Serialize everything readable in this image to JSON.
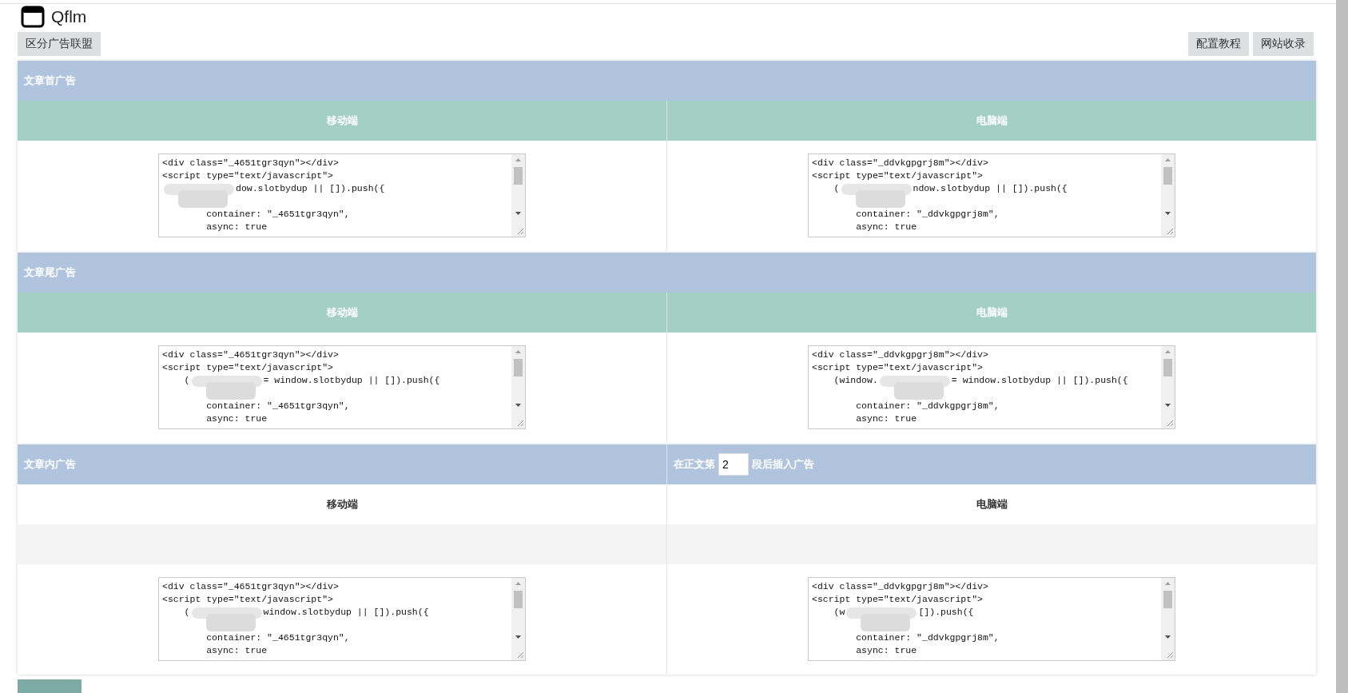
{
  "app": {
    "title": "Qflm"
  },
  "toolbar": {
    "left_buttons": [
      "区分广告联盟"
    ],
    "right_buttons": [
      "配置教程",
      "网站收录"
    ]
  },
  "sections": [
    {
      "title": "文章首广告",
      "kind": "standard",
      "columns": [
        {
          "label": "移动端",
          "head": [
            "<div class=\"_4651tgr3qyn\"></div>",
            "<script type=\"text/javascript\">"
          ],
          "redacted": {
            "after": "dow.slotbydup || []).push({"
          },
          "tail": [
            "        container: \"_4651tgr3qyn\",",
            "        async: true"
          ]
        },
        {
          "label": "电脑端",
          "head": [
            "<div class=\"_ddvkgpgrj8m\"></div>",
            "<script type=\"text/javascript\">"
          ],
          "redacted": {
            "before": "    (",
            "after": "ndow.slotbydup || []).push({"
          },
          "tail": [
            "        container: \"_ddvkgpgrj8m\",",
            "        async: true"
          ]
        }
      ]
    },
    {
      "title": "文章尾广告",
      "kind": "standard",
      "columns": [
        {
          "label": "移动端",
          "head": [
            "<div class=\"_4651tgr3qyn\"></div>",
            "<script type=\"text/javascript\">"
          ],
          "redacted": {
            "before": "    (",
            "after": "= window.slotbydup || []).push({"
          },
          "tail": [
            "        container: \"_4651tgr3qyn\",",
            "        async: true"
          ]
        },
        {
          "label": "电脑端",
          "head": [
            "<div class=\"_ddvkgpgrj8m\"></div>",
            "<script type=\"text/javascript\">"
          ],
          "redacted": {
            "before": "    (window.",
            "after": "= window.slotbydup || []).push({"
          },
          "tail": [
            "        container: \"_ddvkgpgrj8m\",",
            "        async: true"
          ]
        }
      ]
    },
    {
      "title": "文章内广告",
      "kind": "inline",
      "insert": {
        "before": "在正文第",
        "value": "2",
        "after": "段后插入广告"
      },
      "columns": [
        {
          "label": "移动端",
          "head": [
            "<div class=\"_4651tgr3qyn\"></div>",
            "<script type=\"text/javascript\">"
          ],
          "redacted": {
            "before": "    (",
            "after": "window.slotbydup || []).push({"
          },
          "tail": [
            "        container: \"_4651tgr3qyn\",",
            "        async: true"
          ]
        },
        {
          "label": "电脑端",
          "head": [
            "<div class=\"_ddvkgpgrj8m\"></div>",
            "<script type=\"text/javascript\">"
          ],
          "redacted": {
            "before": "    (w",
            "after": "[]).push({"
          },
          "tail": [
            "        container: \"_ddvkgpgrj8m\",",
            "        async: true"
          ]
        }
      ]
    }
  ]
}
